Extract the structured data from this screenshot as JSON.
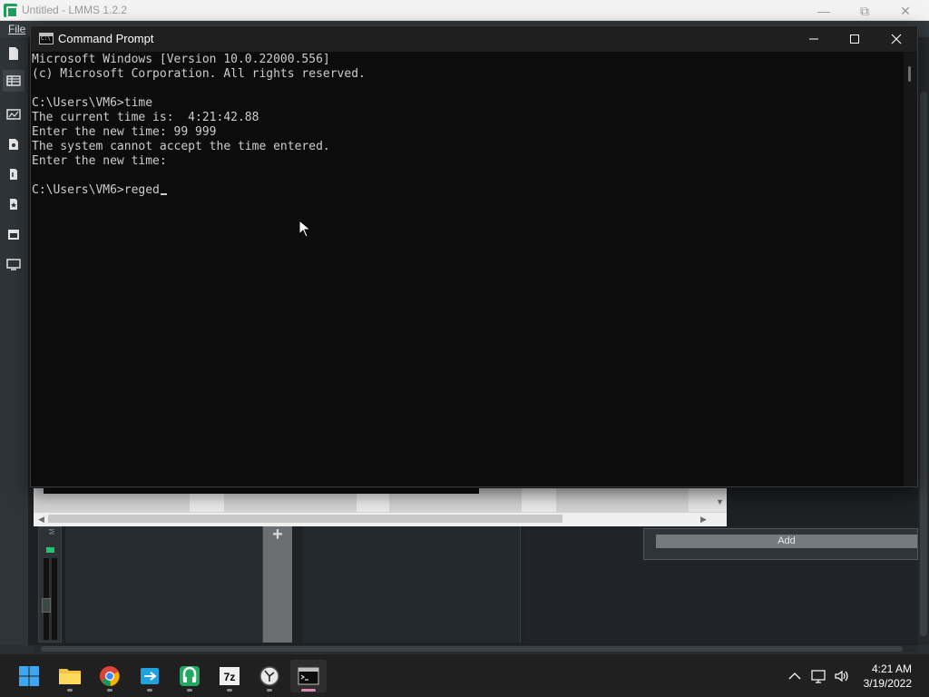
{
  "lmms": {
    "title": "Untitled - LMMS 1.2.2",
    "menu_file": "File",
    "add_button": "Add",
    "window_controls": [
      "minimize",
      "restore",
      "close"
    ],
    "toolbar_icons": [
      "new-project-icon",
      "song-editor-icon",
      "automation-editor-icon",
      "beat-bassline-icon",
      "piano-roll-icon",
      "fx-mixer-icon",
      "project-notes-icon",
      "controller-rack-icon"
    ],
    "mixer_channel_label": "M",
    "mixer_add_label": "+"
  },
  "cmd": {
    "title": "Command Prompt",
    "lines": [
      "Microsoft Windows [Version 10.0.22000.556]",
      "(c) Microsoft Corporation. All rights reserved.",
      "",
      "C:\\Users\\VM6>time",
      "The current time is:  4:21:42.88",
      "Enter the new time: 99 999",
      "The system cannot accept the time entered.",
      "Enter the new time:",
      "",
      "C:\\Users\\VM6>reged"
    ],
    "colors": {
      "background": "#0c0c0c",
      "text": "#cccccc",
      "titlebar": "#1f1f1f"
    }
  },
  "taskbar": {
    "apps": [
      {
        "name": "start-button",
        "icon": "windows-logo-icon"
      },
      {
        "name": "file-explorer",
        "icon": "folder-icon"
      },
      {
        "name": "chrome",
        "icon": "chrome-icon"
      },
      {
        "name": "remote-app",
        "icon": "remote-icon"
      },
      {
        "name": "lmms",
        "icon": "lmms-icon"
      },
      {
        "name": "7zip",
        "icon": "7zip-icon",
        "label": "7z"
      },
      {
        "name": "clock-app",
        "icon": "clock-icon"
      },
      {
        "name": "command-prompt",
        "icon": "terminal-icon",
        "active": true
      }
    ],
    "tray_icons": [
      "chevron-up-icon",
      "network-icon",
      "volume-icon"
    ],
    "time": "4:21 AM",
    "date": "3/19/2022"
  }
}
